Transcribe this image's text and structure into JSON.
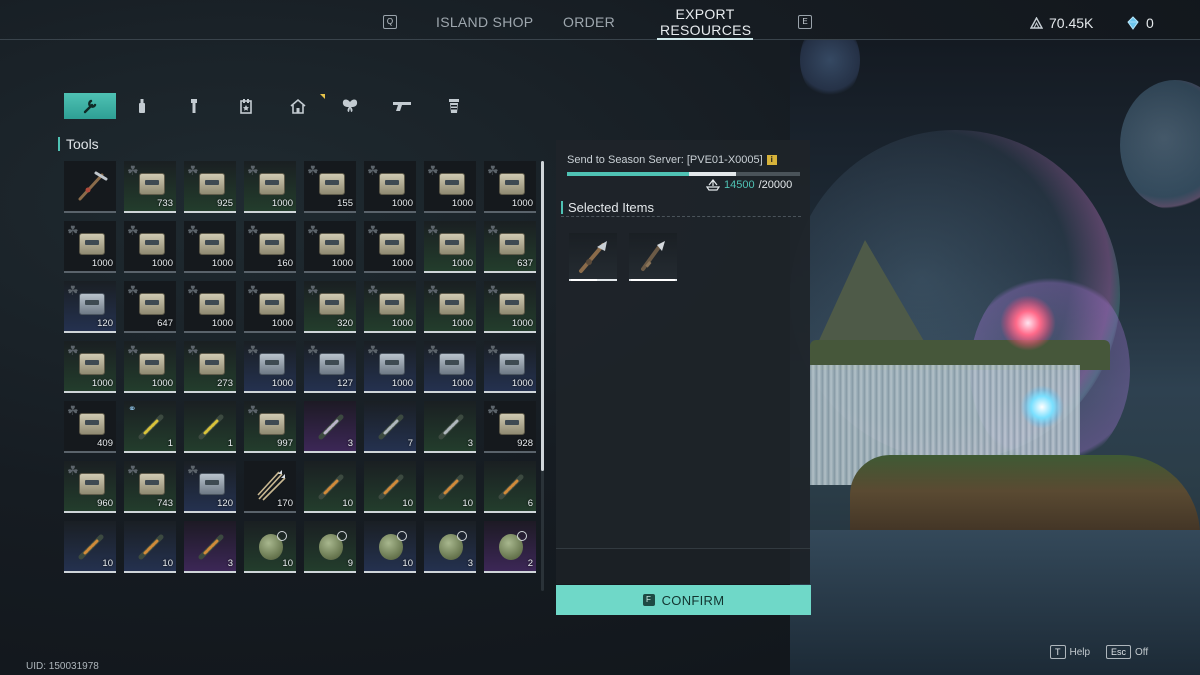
{
  "top_tabs": {
    "left_key": "Q",
    "right_key": "E",
    "island_shop": "ISLAND SHOP",
    "order": "ORDER",
    "export_line1": "EXPORT",
    "export_line2": "RESOURCES"
  },
  "currencies": {
    "primary": "70.45K",
    "secondary": "0"
  },
  "categories": [
    "tools",
    "bottle",
    "flashlight",
    "calendar-box",
    "house",
    "butterfly",
    "pistol",
    "bucket"
  ],
  "section": {
    "title": "Tools"
  },
  "grid_items": [
    {
      "rarity": "dark",
      "kind": "tool",
      "qty": ""
    },
    {
      "rarity": "green",
      "kind": "box",
      "qty": "733"
    },
    {
      "rarity": "green",
      "kind": "box",
      "qty": "925"
    },
    {
      "rarity": "green",
      "kind": "box",
      "qty": "1000"
    },
    {
      "rarity": "dark",
      "kind": "box",
      "qty": "155"
    },
    {
      "rarity": "dark",
      "kind": "box",
      "qty": "1000"
    },
    {
      "rarity": "dark",
      "kind": "box",
      "qty": "1000"
    },
    {
      "rarity": "dark",
      "kind": "box",
      "qty": "1000"
    },
    {
      "rarity": "dark",
      "kind": "box",
      "qty": "1000"
    },
    {
      "rarity": "dark",
      "kind": "box",
      "qty": "1000"
    },
    {
      "rarity": "dark",
      "kind": "box",
      "qty": "1000"
    },
    {
      "rarity": "dark",
      "kind": "box",
      "qty": "160"
    },
    {
      "rarity": "dark",
      "kind": "box",
      "qty": "1000"
    },
    {
      "rarity": "dark",
      "kind": "box",
      "qty": "1000"
    },
    {
      "rarity": "green",
      "kind": "box",
      "qty": "1000"
    },
    {
      "rarity": "green",
      "kind": "box",
      "qty": "637"
    },
    {
      "rarity": "blue",
      "kind": "steel",
      "qty": "120"
    },
    {
      "rarity": "dark",
      "kind": "box",
      "qty": "647"
    },
    {
      "rarity": "dark",
      "kind": "box",
      "qty": "1000"
    },
    {
      "rarity": "dark",
      "kind": "box",
      "qty": "1000"
    },
    {
      "rarity": "green",
      "kind": "box",
      "qty": "320"
    },
    {
      "rarity": "green",
      "kind": "box",
      "qty": "1000"
    },
    {
      "rarity": "green",
      "kind": "box",
      "qty": "1000"
    },
    {
      "rarity": "green",
      "kind": "box",
      "qty": "1000"
    },
    {
      "rarity": "green",
      "kind": "box",
      "qty": "1000"
    },
    {
      "rarity": "green",
      "kind": "box",
      "qty": "1000"
    },
    {
      "rarity": "green",
      "kind": "box",
      "qty": "273"
    },
    {
      "rarity": "blue",
      "kind": "steel",
      "qty": "1000"
    },
    {
      "rarity": "blue",
      "kind": "steel",
      "qty": "127"
    },
    {
      "rarity": "blue",
      "kind": "steel",
      "qty": "1000"
    },
    {
      "rarity": "blue",
      "kind": "steel",
      "qty": "1000"
    },
    {
      "rarity": "blue",
      "kind": "steel",
      "qty": "1000"
    },
    {
      "rarity": "dark",
      "kind": "box",
      "qty": "409"
    },
    {
      "rarity": "green",
      "kind": "stick-yellow",
      "qty": "1",
      "link": true
    },
    {
      "rarity": "green",
      "kind": "stick-yellow",
      "qty": "1"
    },
    {
      "rarity": "green",
      "kind": "box",
      "qty": "997"
    },
    {
      "rarity": "purple",
      "kind": "stick-purple",
      "qty": "3"
    },
    {
      "rarity": "blue",
      "kind": "stick-gray",
      "qty": "7"
    },
    {
      "rarity": "green",
      "kind": "stick-gray",
      "qty": "3"
    },
    {
      "rarity": "dark",
      "kind": "box",
      "qty": "928"
    },
    {
      "rarity": "green",
      "kind": "box",
      "qty": "960"
    },
    {
      "rarity": "green",
      "kind": "box",
      "qty": "743"
    },
    {
      "rarity": "blue",
      "kind": "steel",
      "qty": "120"
    },
    {
      "rarity": "dark",
      "kind": "arrows",
      "qty": "170"
    },
    {
      "rarity": "green",
      "kind": "stick-orange",
      "qty": "10"
    },
    {
      "rarity": "green",
      "kind": "stick-orange",
      "qty": "10"
    },
    {
      "rarity": "green",
      "kind": "stick-orange",
      "qty": "10"
    },
    {
      "rarity": "green",
      "kind": "stick-orange",
      "qty": "6"
    },
    {
      "rarity": "blue",
      "kind": "stick-orange",
      "qty": "10"
    },
    {
      "rarity": "blue",
      "kind": "stick-orange",
      "qty": "10"
    },
    {
      "rarity": "purple",
      "kind": "stick-orange",
      "qty": "3"
    },
    {
      "rarity": "green",
      "kind": "grenade",
      "qty": "10"
    },
    {
      "rarity": "green",
      "kind": "grenade",
      "qty": "9"
    },
    {
      "rarity": "blue",
      "kind": "grenade",
      "qty": "10"
    },
    {
      "rarity": "blue",
      "kind": "grenade",
      "qty": "3"
    },
    {
      "rarity": "purple",
      "kind": "grenade",
      "qty": "2"
    }
  ],
  "server": {
    "label": "Send to Season Server: [PVE01-X0005]",
    "info": "i",
    "current": "14500",
    "max": "/20000",
    "fill_fraction": 0.725
  },
  "selected": {
    "title": "Selected Items",
    "items": [
      {
        "kind": "tool-knife",
        "bar_fraction": 0.6
      },
      {
        "kind": "tool-blade",
        "bar_fraction": 1.0
      }
    ]
  },
  "confirm": {
    "key": "F",
    "label": "CONFIRM"
  },
  "footer": {
    "uid": "UID: 150031978",
    "help_key": "T",
    "help_label": "Help",
    "off_key": "Esc",
    "off_label": "Off"
  },
  "colors": {
    "accent": "#4fc2b4",
    "confirm_bg": "#6fd8c8"
  }
}
